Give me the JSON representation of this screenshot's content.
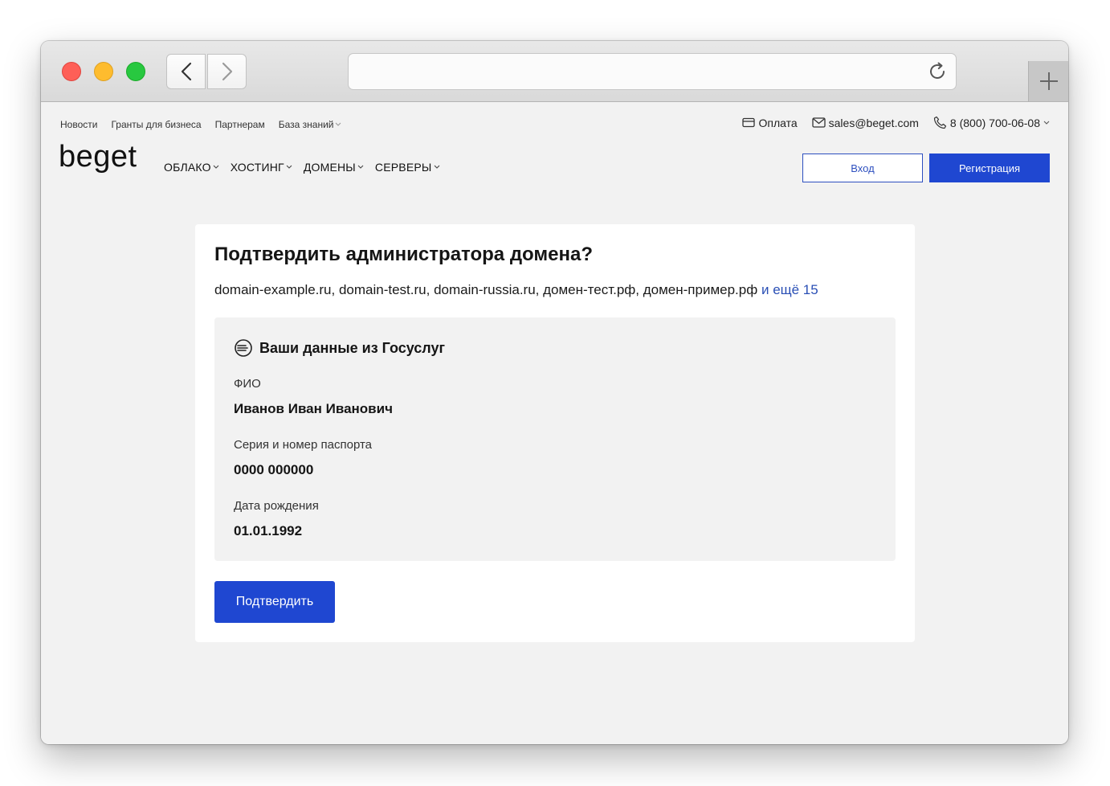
{
  "browser": {
    "icons": {
      "back": "chevron-left-icon",
      "forward": "chevron-right-icon",
      "reload": "reload-icon",
      "new_tab": "plus-icon"
    }
  },
  "topbar": {
    "links": [
      "Новости",
      "Гранты для бизнеса",
      "Партнерам",
      "База знаний"
    ],
    "payment": "Оплата",
    "email": "sales@beget.com",
    "phone": "8 (800) 700-06-08"
  },
  "header": {
    "logo": "beget",
    "nav": [
      "ОБЛАКО",
      "ХОСТИНГ",
      "ДОМЕНЫ",
      "СЕРВЕРЫ"
    ],
    "login": "Вход",
    "register": "Регистрация"
  },
  "card": {
    "title": "Подтвердить администратора домена?",
    "domains": "domain-example.ru, domain-test.ru, domain-russia.ru, домен-тест.рф, домен-пример.рф",
    "more": "и ещё 15",
    "panel_title": "Ваши данные из Госуслуг",
    "fields": [
      {
        "label": "ФИО",
        "value": "Иванов Иван Иванович"
      },
      {
        "label": "Серия и номер паспорта",
        "value": "0000 000000"
      },
      {
        "label": "Дата рождения",
        "value": "01.01.1992"
      }
    ],
    "confirm": "Подтвердить"
  },
  "colors": {
    "primary": "#1f47d1",
    "link": "#2a4fb5",
    "page_bg": "#f2f2f2"
  }
}
